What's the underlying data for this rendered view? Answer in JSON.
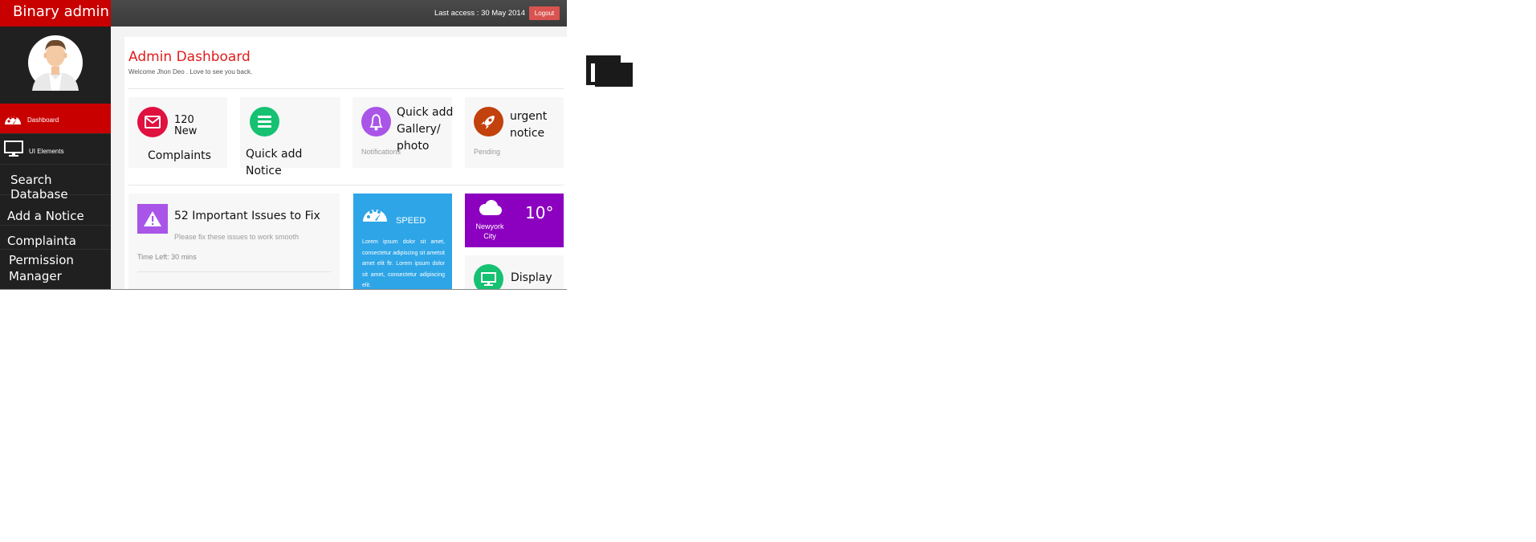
{
  "header": {
    "brand": "Binary admin",
    "last_access": "Last access : 30 May 2014",
    "logout_label": "Logout"
  },
  "sidebar": {
    "items": [
      {
        "label": "Dashboard",
        "icon": "dashboard-icon"
      },
      {
        "label": "UI Elements",
        "icon": "desktop-icon"
      },
      {
        "label": "Search Database"
      },
      {
        "label": "Add a Notice"
      },
      {
        "label": "Complainta"
      },
      {
        "label": "Permission Manager"
      }
    ]
  },
  "main": {
    "title": "Admin Dashboard",
    "welcome": "Welcome Jhon Deo . Love to see you back.",
    "tiles": [
      {
        "line1": "120",
        "line2": "New",
        "caption": "Complaints",
        "icon": "envelope-icon",
        "color": "#e0103f"
      },
      {
        "caption": "Quick add Notice",
        "icon": "list-icon",
        "color": "#16c172"
      },
      {
        "caption": "Quick add Gallery/ photo",
        "sub": "Notifications",
        "icon": "bell-icon",
        "color": "#a855e8"
      },
      {
        "caption": "urgent notice",
        "sub": "Pending",
        "icon": "rocket-icon",
        "color": "#c2410c"
      }
    ],
    "issues": {
      "title": "52 Important Issues to Fix",
      "sub": "Please fix these issues to work smooth",
      "time_left": "Time Left: 30 mins",
      "icon": "warning-icon",
      "color": "#a855e8"
    },
    "speed": {
      "title": "SPEED",
      "body": "Lorem ipsum dolor sit amet, consectetur adipiscing sit ametsit amet elit ftr. Lorem ipsum dolor sit amet, consectetur adipiscing elit.",
      "icon": "speedometer-icon",
      "color": "#2ea5e6"
    },
    "weather": {
      "city": "Newyork City",
      "temp": "10°",
      "icon": "cloud-icon",
      "color": "#8c00bf"
    },
    "display": {
      "label": "Display",
      "icon": "monitor-icon",
      "color": "#16c172"
    }
  }
}
